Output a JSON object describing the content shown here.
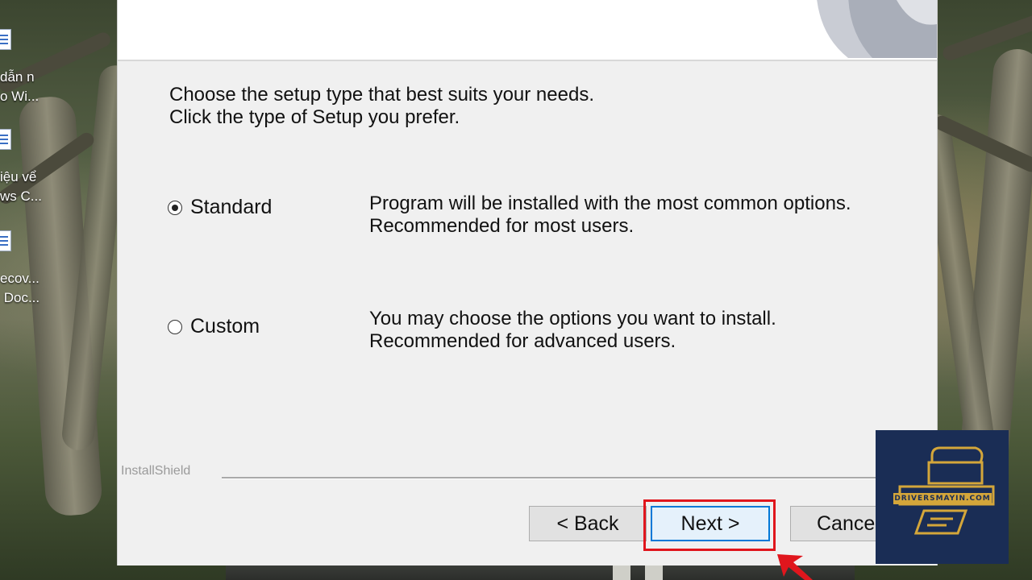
{
  "desktop": {
    "icons": [
      {
        "label": "dẫn n\no Wi..."
      },
      {
        "label": "iệu vể\nws C..."
      },
      {
        "label": "ecov...\n Doc..."
      }
    ]
  },
  "installer": {
    "intro_line1": "Choose the setup type that best suits your needs.",
    "intro_line2": "Click the type of Setup you prefer.",
    "options": [
      {
        "label": "Standard",
        "selected": true,
        "desc_line1": "Program will be installed with the most common options.",
        "desc_line2": "Recommended for most users."
      },
      {
        "label": "Custom",
        "selected": false,
        "desc_line1": "You may choose the options you want to install.",
        "desc_line2": "Recommended for advanced users."
      }
    ],
    "brand": "InstallShield",
    "buttons": {
      "back": "< Back",
      "next": "Next >",
      "cancel": "Cancel"
    }
  },
  "watermark": {
    "text": "DRIVERSMAYIN.COM"
  },
  "colors": {
    "highlight": "#e0161d",
    "logo_bg": "#1a2d55",
    "logo_gold": "#d4a63a"
  }
}
